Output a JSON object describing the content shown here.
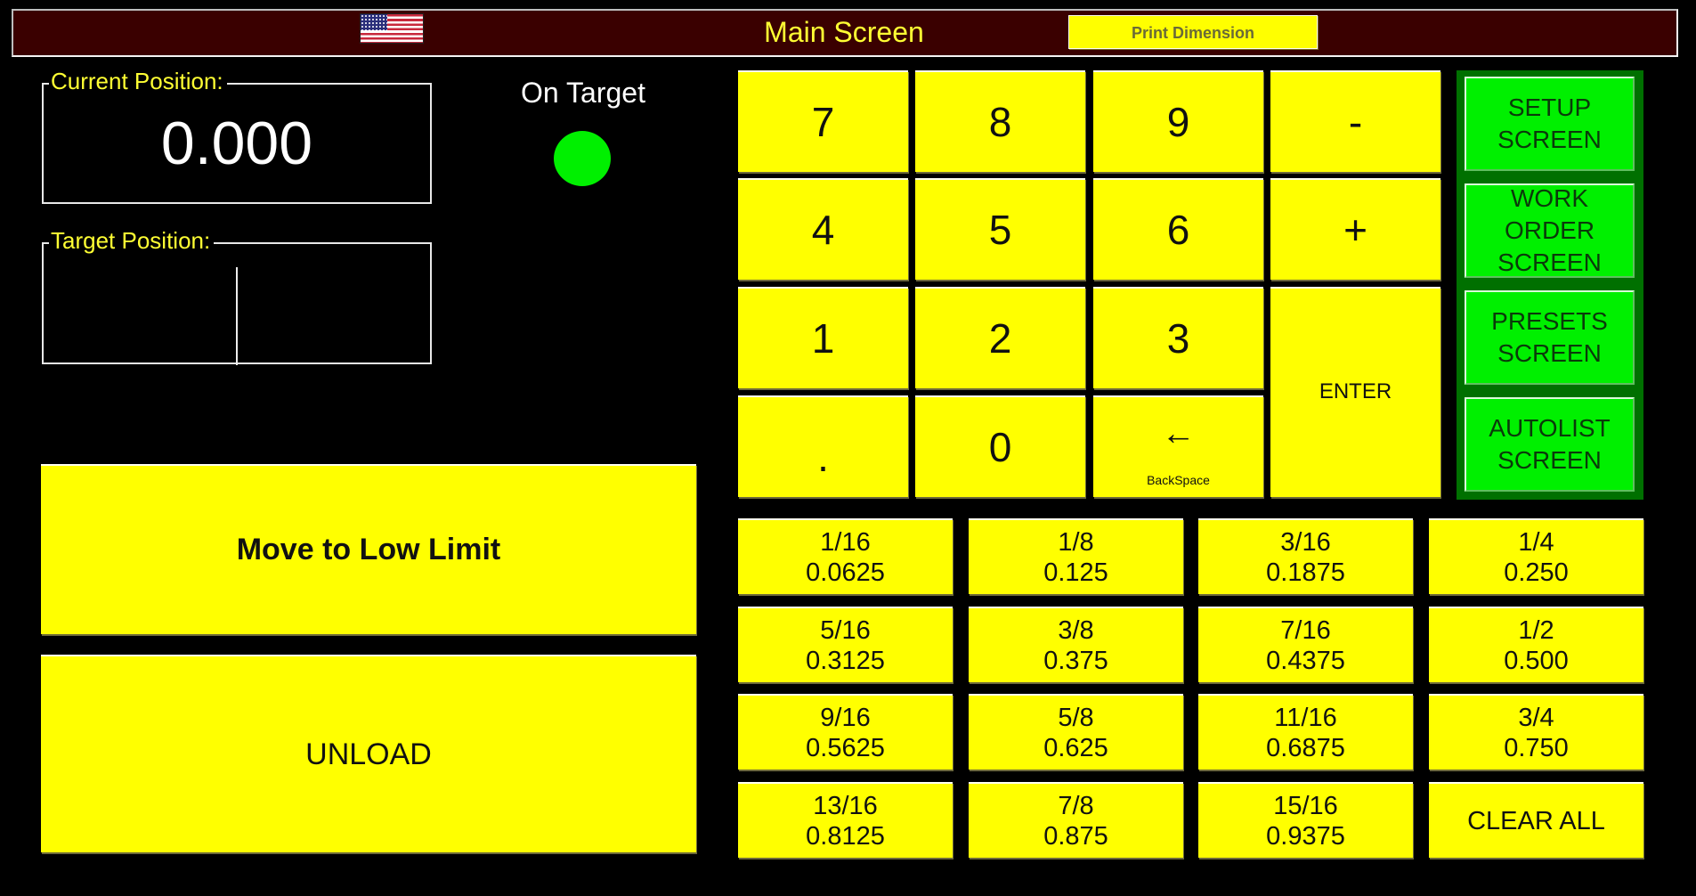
{
  "header": {
    "flag_icon": "us-flag-icon",
    "title": "Main Screen",
    "print_dimension_label": "Print Dimension",
    "background_color": "#3a0000",
    "title_color": "#ffff33"
  },
  "position": {
    "current_label": "Current Position:",
    "current_value": "0.000",
    "target_label": "Target Position:",
    "target_value": ""
  },
  "status": {
    "on_target_label": "On Target",
    "on_target_color": "#00f000"
  },
  "actions": {
    "move_low_limit_label": "Move to Low Limit",
    "unload_label": "UNLOAD"
  },
  "keypad": {
    "keys": [
      "7",
      "8",
      "9",
      "-",
      "4",
      "5",
      "6",
      "+",
      "1",
      "2",
      "3",
      ".",
      "0"
    ],
    "backspace_glyph": "←",
    "backspace_label": "BackSpace",
    "enter_label": "ENTER"
  },
  "nav": {
    "items": [
      {
        "label": "SETUP\nSCREEN"
      },
      {
        "label": "WORK ORDER\nSCREEN"
      },
      {
        "label": "PRESETS\nSCREEN"
      },
      {
        "label": "AUTOLIST\nSCREEN"
      }
    ]
  },
  "fractions": {
    "items": [
      {
        "fraction": "1/16",
        "decimal": "0.0625"
      },
      {
        "fraction": "1/8",
        "decimal": "0.125"
      },
      {
        "fraction": "3/16",
        "decimal": "0.1875"
      },
      {
        "fraction": "1/4",
        "decimal": "0.250"
      },
      {
        "fraction": "5/16",
        "decimal": "0.3125"
      },
      {
        "fraction": "3/8",
        "decimal": "0.375"
      },
      {
        "fraction": "7/16",
        "decimal": "0.4375"
      },
      {
        "fraction": "1/2",
        "decimal": "0.500"
      },
      {
        "fraction": "9/16",
        "decimal": "0.5625"
      },
      {
        "fraction": "5/8",
        "decimal": "0.625"
      },
      {
        "fraction": "11/16",
        "decimal": "0.6875"
      },
      {
        "fraction": "3/4",
        "decimal": "0.750"
      },
      {
        "fraction": "13/16",
        "decimal": "0.8125"
      },
      {
        "fraction": "7/8",
        "decimal": "0.875"
      },
      {
        "fraction": "15/16",
        "decimal": "0.9375"
      }
    ],
    "clear_all_label": "CLEAR ALL"
  },
  "colors": {
    "button_yellow": "#ffff00",
    "nav_green": "#00f000",
    "nav_panel_green": "#007000"
  }
}
